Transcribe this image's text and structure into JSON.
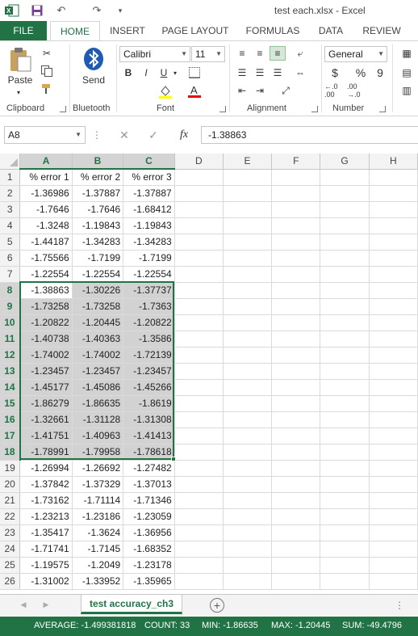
{
  "window": {
    "title": "test each.xlsx - Excel"
  },
  "tabs": [
    "FILE",
    "HOME",
    "INSERT",
    "PAGE LAYOUT",
    "FORMULAS",
    "DATA",
    "REVIEW"
  ],
  "ribbon": {
    "clipboard": {
      "paste": "Paste",
      "label": "Clipboard"
    },
    "bluetooth": {
      "send": "Send",
      "label": "Bluetooth"
    },
    "font": {
      "name": "Calibri",
      "size": "11",
      "label": "Font",
      "bold": "B",
      "italic": "I",
      "underline": "U",
      "font_color_glyph": "A"
    },
    "alignment": {
      "label": "Alignment"
    },
    "number": {
      "format": "General",
      "label": "Number",
      "currency": "$",
      "percent": "%",
      "comma": "9",
      "inc_decimal": "←.0 .00",
      "dec_decimal": ".00 →.0"
    }
  },
  "formula_bar": {
    "name_box": "A8",
    "fx_label": "fx",
    "value": "-1.38863"
  },
  "columns": [
    "A",
    "B",
    "C",
    "D",
    "E",
    "F",
    "G",
    "H"
  ],
  "rows": [
    {
      "n": "1",
      "a": "% error 1",
      "b": "% error 2",
      "c": "% error 3"
    },
    {
      "n": "2",
      "a": "-1.36986",
      "b": "-1.37887",
      "c": "-1.37887"
    },
    {
      "n": "3",
      "a": "-1.7646",
      "b": "-1.7646",
      "c": "-1.68412"
    },
    {
      "n": "4",
      "a": "-1.3248",
      "b": "-1.19843",
      "c": "-1.19843"
    },
    {
      "n": "5",
      "a": "-1.44187",
      "b": "-1.34283",
      "c": "-1.34283"
    },
    {
      "n": "6",
      "a": "-1.75566",
      "b": "-1.7199",
      "c": "-1.7199"
    },
    {
      "n": "7",
      "a": "-1.22554",
      "b": "-1.22554",
      "c": "-1.22554"
    },
    {
      "n": "8",
      "a": "-1.38863",
      "b": "-1.30226",
      "c": "-1.37737"
    },
    {
      "n": "9",
      "a": "-1.73258",
      "b": "-1.73258",
      "c": "-1.7363"
    },
    {
      "n": "10",
      "a": "-1.20822",
      "b": "-1.20445",
      "c": "-1.20822"
    },
    {
      "n": "11",
      "a": "-1.40738",
      "b": "-1.40363",
      "c": "-1.3586"
    },
    {
      "n": "12",
      "a": "-1.74002",
      "b": "-1.74002",
      "c": "-1.72139"
    },
    {
      "n": "13",
      "a": "-1.23457",
      "b": "-1.23457",
      "c": "-1.23457"
    },
    {
      "n": "14",
      "a": "-1.45177",
      "b": "-1.45086",
      "c": "-1.45266"
    },
    {
      "n": "15",
      "a": "-1.86279",
      "b": "-1.86635",
      "c": "-1.8619"
    },
    {
      "n": "16",
      "a": "-1.32661",
      "b": "-1.31128",
      "c": "-1.31308"
    },
    {
      "n": "17",
      "a": "-1.41751",
      "b": "-1.40963",
      "c": "-1.41413"
    },
    {
      "n": "18",
      "a": "-1.78991",
      "b": "-1.79958",
      "c": "-1.78618"
    },
    {
      "n": "19",
      "a": "-1.26994",
      "b": "-1.26692",
      "c": "-1.27482"
    },
    {
      "n": "20",
      "a": "-1.37842",
      "b": "-1.37329",
      "c": "-1.37013"
    },
    {
      "n": "21",
      "a": "-1.73162",
      "b": "-1.71114",
      "c": "-1.71346"
    },
    {
      "n": "22",
      "a": "-1.23213",
      "b": "-1.23186",
      "c": "-1.23059"
    },
    {
      "n": "23",
      "a": "-1.35417",
      "b": "-1.3624",
      "c": "-1.36956"
    },
    {
      "n": "24",
      "a": "-1.71741",
      "b": "-1.7145",
      "c": "-1.68352"
    },
    {
      "n": "25",
      "a": "-1.19575",
      "b": "-1.2049",
      "c": "-1.23178"
    },
    {
      "n": "26",
      "a": "-1.31002",
      "b": "-1.33952",
      "c": "-1.35965"
    }
  ],
  "selection": {
    "first_row": 8,
    "last_row": 18,
    "active_row": 8
  },
  "sheet_tab": "test accuracy_ch3",
  "status": {
    "average": "AVERAGE: -1.499381818",
    "count": "COUNT: 33",
    "min": "MIN: -1.86635",
    "max": "MAX: -1.20445",
    "sum": "SUM: -49.4796"
  },
  "colors": {
    "accent": "#217346",
    "selection_fill": "#d2d2d2"
  }
}
